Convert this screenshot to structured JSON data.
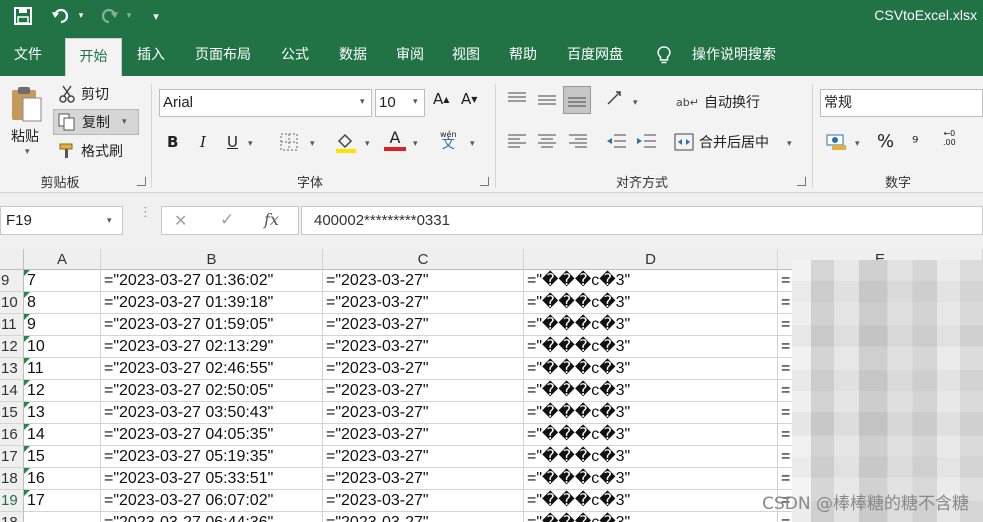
{
  "title_bar": {
    "filename": "CSVtoExcel.xlsx"
  },
  "tabs": [
    "文件",
    "开始",
    "插入",
    "页面布局",
    "公式",
    "数据",
    "审阅",
    "视图",
    "帮助",
    "百度网盘",
    "操作说明搜索"
  ],
  "clipboard": {
    "paste": "粘贴",
    "cut": "剪切",
    "copy": "复制",
    "format_painter": "格式刷",
    "group": "剪贴板"
  },
  "font": {
    "name": "Arial",
    "size": "10",
    "group": "字体",
    "bold": "B",
    "italic": "I",
    "underline": "U",
    "font_color_letter": "A",
    "wen_top": "wén",
    "wen_char": "文",
    "font_color": "#e02020",
    "highlight_color": "#ffe000"
  },
  "alignment": {
    "wrap": "自动换行",
    "merge": "合并后居中",
    "group": "对齐方式"
  },
  "number": {
    "format": "常规",
    "group": "数字",
    "percent": "%"
  },
  "formula_bar": {
    "name_box": "F19",
    "formula": "400002*********0331",
    "fx": "fx"
  },
  "columns": [
    "A",
    "B",
    "C",
    "D",
    "E"
  ],
  "rows": [
    {
      "num": "9",
      "a": "7",
      "b": "=\"2023-03-27 01:36:02\"",
      "c": "=\"2023-03-27\"",
      "d": "=\"���c�3\"",
      "e": "="
    },
    {
      "num": "10",
      "a": "8",
      "b": "=\"2023-03-27 01:39:18\"",
      "c": "=\"2023-03-27\"",
      "d": "=\"���c�3\"",
      "e": "="
    },
    {
      "num": "11",
      "a": "9",
      "b": "=\"2023-03-27 01:59:05\"",
      "c": "=\"2023-03-27\"",
      "d": "=\"���c�3\"",
      "e": "="
    },
    {
      "num": "12",
      "a": "10",
      "b": "=\"2023-03-27 02:13:29\"",
      "c": "=\"2023-03-27\"",
      "d": "=\"���c�3\"",
      "e": "="
    },
    {
      "num": "13",
      "a": "11",
      "b": "=\"2023-03-27 02:46:55\"",
      "c": "=\"2023-03-27\"",
      "d": "=\"���c�3\"",
      "e": "="
    },
    {
      "num": "14",
      "a": "12",
      "b": "=\"2023-03-27 02:50:05\"",
      "c": "=\"2023-03-27\"",
      "d": "=\"���c�3\"",
      "e": "="
    },
    {
      "num": "15",
      "a": "13",
      "b": "=\"2023-03-27 03:50:43\"",
      "c": "=\"2023-03-27\"",
      "d": "=\"���c�3\"",
      "e": "="
    },
    {
      "num": "16",
      "a": "14",
      "b": "=\"2023-03-27 04:05:35\"",
      "c": "=\"2023-03-27\"",
      "d": "=\"���c�3\"",
      "e": "="
    },
    {
      "num": "17",
      "a": "15",
      "b": "=\"2023-03-27 05:19:35\"",
      "c": "=\"2023-03-27\"",
      "d": "=\"���c�3\"",
      "e": "="
    },
    {
      "num": "18",
      "a": "16",
      "b": "=\"2023-03-27 05:33:51\"",
      "c": "=\"2023-03-27\"",
      "d": "=\"���c�3\"",
      "e": "="
    },
    {
      "num": "19",
      "a": "17",
      "b": "=\"2023-03-27 06:07:02\"",
      "c": "=\"2023-03-27\"",
      "d": "=\"���c�3\"",
      "e": "="
    },
    {
      "num": "18",
      "a": "",
      "b": "=\"2023-03-27 06:44:36\"",
      "c": "=\"2023-03-27\"",
      "d": "=\"���c�3\"",
      "e": "="
    }
  ],
  "watermark": "CSDN @棒棒糖的糖不含糖"
}
